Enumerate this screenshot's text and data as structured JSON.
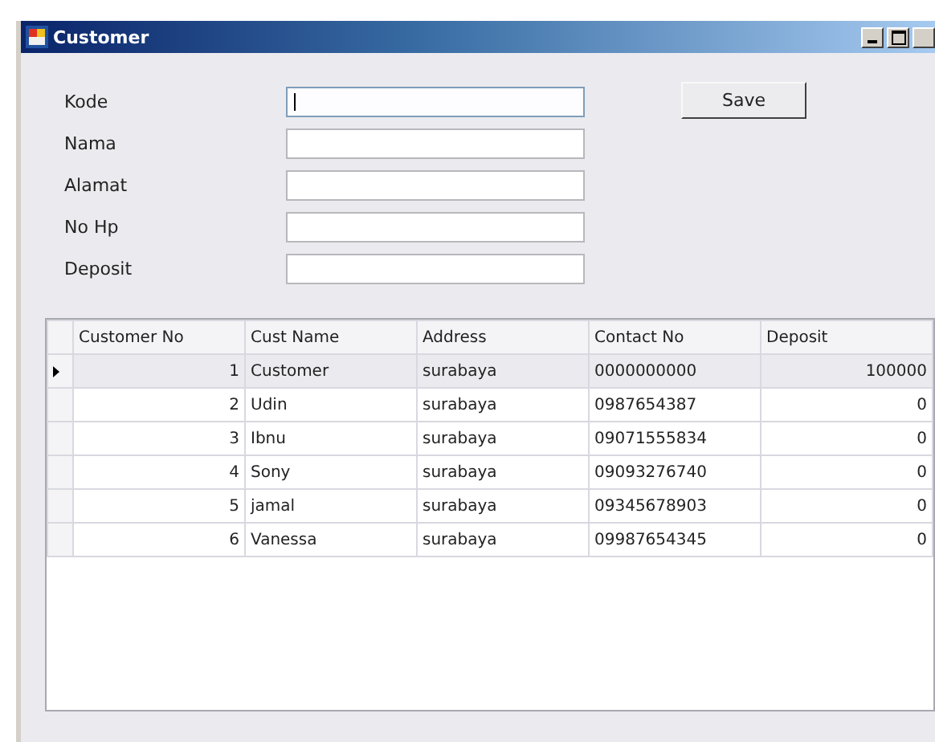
{
  "window": {
    "title": "Customer"
  },
  "form": {
    "fields": [
      {
        "label": "Kode",
        "focused": true
      },
      {
        "label": "Nama",
        "focused": false
      },
      {
        "label": "Alamat",
        "focused": false
      },
      {
        "label": "No Hp",
        "focused": false
      },
      {
        "label": "Deposit",
        "focused": false
      }
    ],
    "buttons": [
      "Save"
    ]
  },
  "table": {
    "columns": [
      {
        "label": "Customer No",
        "kind": "number"
      },
      {
        "label": "Cust Name",
        "kind": "text"
      },
      {
        "label": "Address",
        "kind": "text"
      },
      {
        "label": "Contact No",
        "kind": "text"
      },
      {
        "label": "Deposit",
        "kind": "number"
      }
    ],
    "rows": [
      {
        "selected": true,
        "cells": [
          "1",
          "Customer",
          "surabaya",
          "0000000000",
          "100000"
        ]
      },
      {
        "selected": false,
        "cells": [
          "2",
          "Udin",
          "surabaya",
          "0987654387",
          "0"
        ]
      },
      {
        "selected": false,
        "cells": [
          "3",
          "Ibnu",
          "surabaya",
          "09071555834",
          "0"
        ]
      },
      {
        "selected": false,
        "cells": [
          "4",
          "Sony",
          "surabaya",
          "09093276740",
          "0"
        ]
      },
      {
        "selected": false,
        "cells": [
          "5",
          "jamal",
          "surabaya",
          "09345678903",
          "0"
        ]
      },
      {
        "selected": false,
        "cells": [
          "6",
          "Vanessa",
          "surabaya",
          "09987654345",
          "0"
        ]
      }
    ]
  }
}
